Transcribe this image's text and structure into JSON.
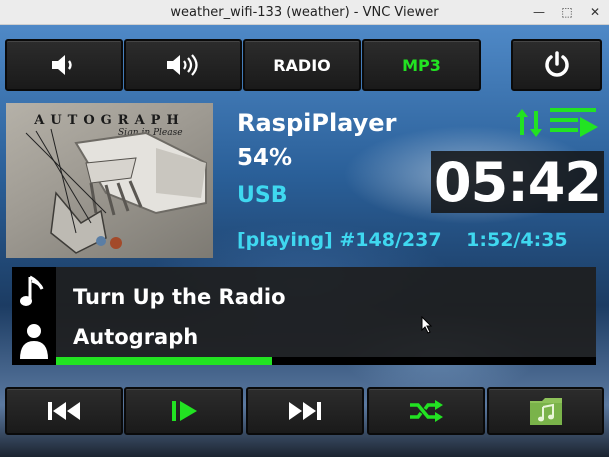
{
  "window": {
    "title": "weather_wifi-133 (weather) - VNC Viewer"
  },
  "top_controls": {
    "vol_down_icon": "speaker-low-icon",
    "vol_up_icon": "speaker-high-icon",
    "radio_label": "RADIO",
    "mp3_label": "MP3",
    "power_icon": "power-icon"
  },
  "album": {
    "band": "AUTOGRAPH",
    "subtitle": "Sign in Please"
  },
  "player": {
    "name": "RaspiPlayer",
    "volume": "54%",
    "source": "USB",
    "status": "[playing] #148/237",
    "time": "1:52/4:35",
    "clock": "05:42"
  },
  "now_playing": {
    "track": "Turn Up the Radio",
    "artist": "Autograph",
    "progress": 0.4
  },
  "bottom_controls": {
    "prev_icon": "skip-back-icon",
    "play_icon": "play-pause-icon",
    "next_icon": "skip-forward-icon",
    "shuffle_icon": "shuffle-icon",
    "folder_icon": "music-folder-icon"
  },
  "colors": {
    "accent": "#22e322",
    "info": "#3fd8f0"
  }
}
